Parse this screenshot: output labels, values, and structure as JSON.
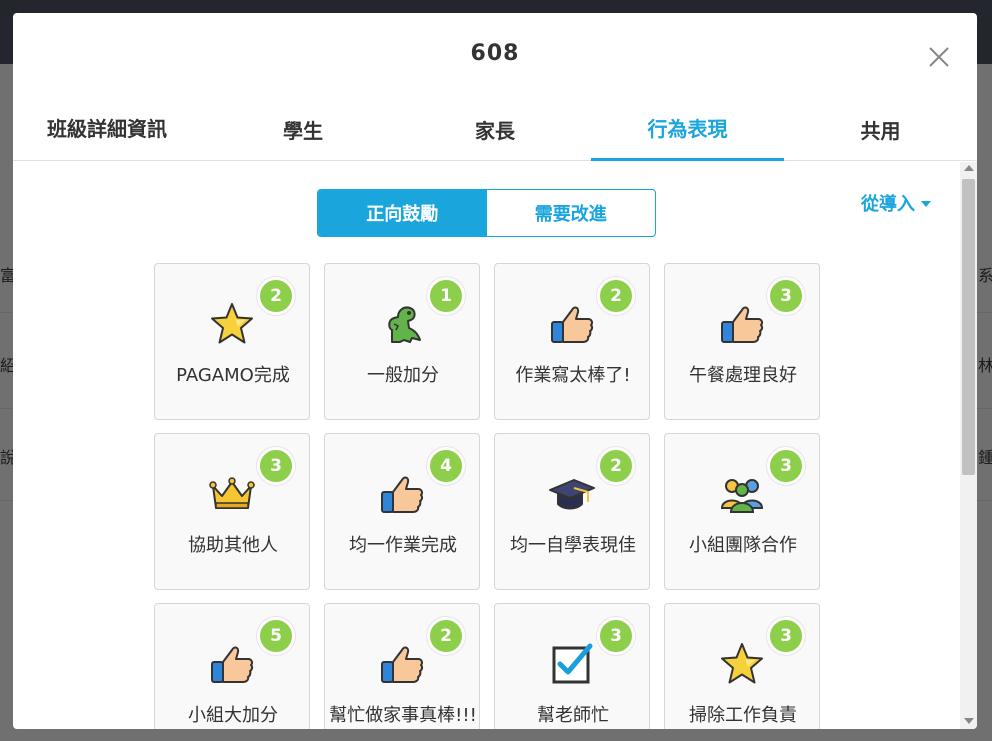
{
  "background": {
    "left_texts": [
      "富",
      "紹",
      "說"
    ],
    "right_texts": [
      "系",
      "林",
      "鍾"
    ]
  },
  "modal": {
    "title": "608",
    "tabs": [
      {
        "label": "班級詳細資訊",
        "active": false
      },
      {
        "label": "學生",
        "active": false
      },
      {
        "label": "家長",
        "active": false
      },
      {
        "label": "行為表現",
        "active": true
      },
      {
        "label": "共用",
        "active": false
      }
    ],
    "segment": {
      "positive": "正向鼓勵",
      "improve": "需要改進",
      "selected": "positive"
    },
    "import_label": "從導入",
    "accent_color": "#1aa5dd",
    "badge_color": "#8dcf4a"
  },
  "behaviors": [
    {
      "label": "PAGAMO完成",
      "count": "2",
      "icon": "star-icon"
    },
    {
      "label": "一般加分",
      "count": "1",
      "icon": "dinosaur-icon"
    },
    {
      "label": "作業寫太棒了!",
      "count": "2",
      "icon": "thumbs-up-icon"
    },
    {
      "label": "午餐處理良好",
      "count": "3",
      "icon": "thumbs-up-icon"
    },
    {
      "label": "協助其他人",
      "count": "3",
      "icon": "crown-icon"
    },
    {
      "label": "均一作業完成",
      "count": "4",
      "icon": "thumbs-up-icon"
    },
    {
      "label": "均一自學表現佳",
      "count": "2",
      "icon": "graduation-cap-icon"
    },
    {
      "label": "小組團隊合作",
      "count": "3",
      "icon": "team-icon"
    },
    {
      "label": "小組大加分",
      "count": "5",
      "icon": "thumbs-up-icon"
    },
    {
      "label": "幫忙做家事真棒!!!",
      "count": "2",
      "icon": "thumbs-up-icon"
    },
    {
      "label": "幫老師忙",
      "count": "3",
      "icon": "checkbox-icon"
    },
    {
      "label": "掃除工作負責",
      "count": "3",
      "icon": "star-icon"
    }
  ]
}
